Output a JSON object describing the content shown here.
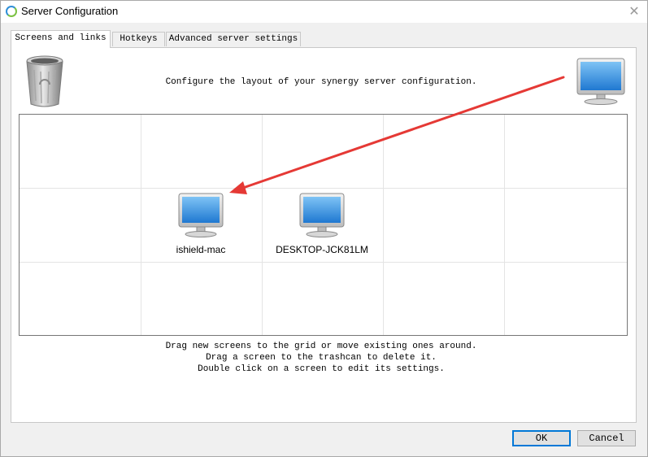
{
  "window": {
    "title": "Server Configuration",
    "close_glyph": "✕",
    "app_icon": "synergy-ring-icon"
  },
  "tabs": [
    {
      "label": "Screens and links",
      "active": true
    },
    {
      "label": "Hotkeys",
      "active": false
    },
    {
      "label": "Advanced server settings",
      "active": false
    }
  ],
  "screens_tab": {
    "instruction": "Configure the layout of your synergy server configuration.",
    "trash_icon": "trashcan-icon",
    "new_screen_icon": "monitor-icon",
    "grid": {
      "columns": 5,
      "rows": 3
    },
    "screens": [
      {
        "name": "ishield-mac",
        "col": 1,
        "row": 1
      },
      {
        "name": "DESKTOP-JCK81LM",
        "col": 2,
        "row": 1
      }
    ],
    "hints": [
      "Drag new screens to the grid or move existing ones around.",
      "Drag a screen to the trashcan to delete it.",
      "Double click on a screen to edit its settings."
    ]
  },
  "buttons": {
    "ok": "OK",
    "cancel": "Cancel"
  },
  "colors": {
    "annotation_arrow": "#e53935",
    "default_button_border": "#0078d7"
  }
}
